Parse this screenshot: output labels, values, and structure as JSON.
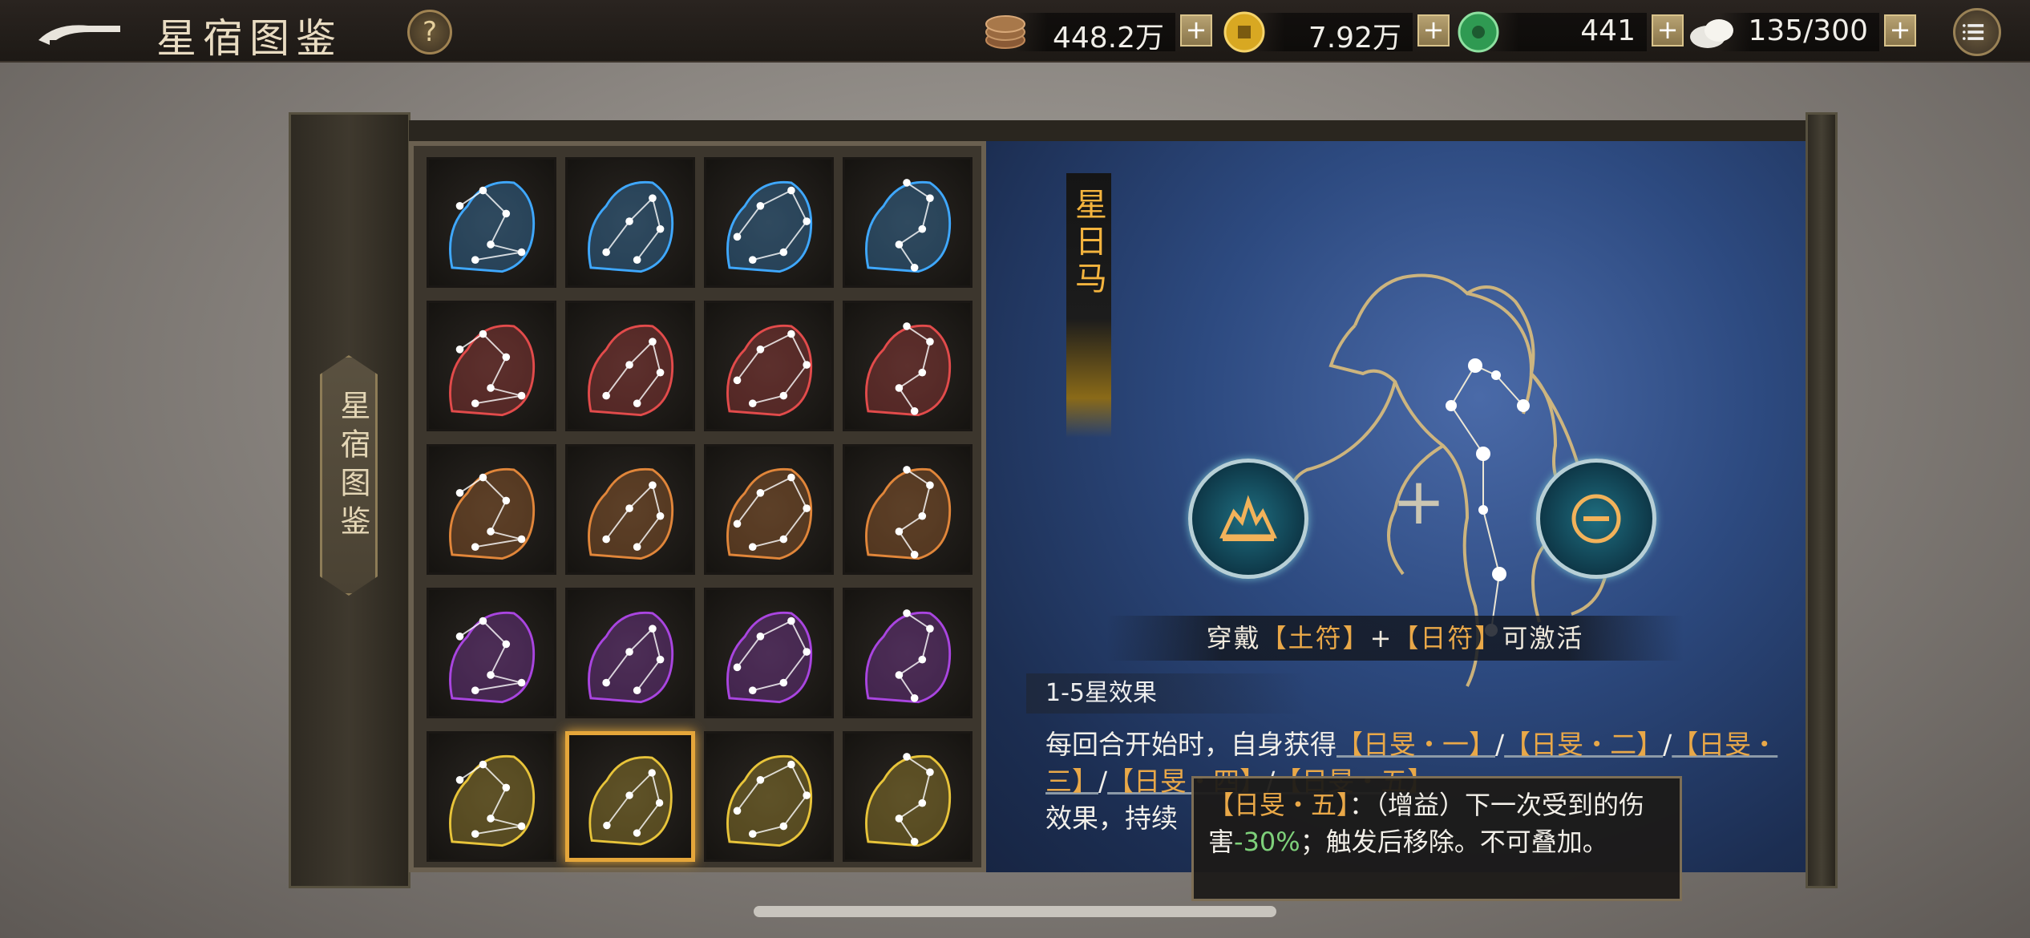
{
  "header": {
    "title": "星宿图鉴",
    "help_label": "?",
    "resources": [
      {
        "name": "copper-coins",
        "value": "448.2万",
        "plus": "+"
      },
      {
        "name": "gold-coin",
        "value": "7.92万",
        "plus": "+"
      },
      {
        "name": "jade",
        "value": "441",
        "plus": "+"
      },
      {
        "name": "stamina",
        "value": "135/300",
        "plus": "+"
      }
    ]
  },
  "side_tab": {
    "label": "星宿图鉴"
  },
  "grid": {
    "cells": [
      {
        "name": "blue-lion",
        "color": "#3fa8ff"
      },
      {
        "name": "blue-wolf",
        "color": "#3fa8ff"
      },
      {
        "name": "blue-beast",
        "color": "#3fa8ff"
      },
      {
        "name": "blue-serpent",
        "color": "#3fa8ff"
      },
      {
        "name": "red-boar",
        "color": "#e24b4b"
      },
      {
        "name": "red-snake",
        "color": "#e24b4b"
      },
      {
        "name": "red-tiger",
        "color": "#e24b4b"
      },
      {
        "name": "red-monkey",
        "color": "#e24b4b"
      },
      {
        "name": "orange-pheasant",
        "color": "#e1863a"
      },
      {
        "name": "orange-deer",
        "color": "#e1863a"
      },
      {
        "name": "orange-badger",
        "color": "#e1863a"
      },
      {
        "name": "orange-bat",
        "color": "#e1863a"
      },
      {
        "name": "purple-crane",
        "color": "#a945e0"
      },
      {
        "name": "purple-stag",
        "color": "#a945e0"
      },
      {
        "name": "purple-fox",
        "color": "#a945e0"
      },
      {
        "name": "purple-swallow",
        "color": "#a945e0"
      },
      {
        "name": "gold-rat",
        "color": "#e8c43a"
      },
      {
        "name": "gold-horse",
        "color": "#e8c43a",
        "selected": true
      },
      {
        "name": "gold-rabbit",
        "color": "#e8c43a"
      },
      {
        "name": "gold-rooster",
        "color": "#e8c43a"
      }
    ]
  },
  "detail": {
    "name": "星日马",
    "activate": {
      "prefix": "穿戴",
      "item1": "【土符】",
      "joiner": "+",
      "item2": "【日符】",
      "suffix": "可激活"
    },
    "effects_header": "1-5星效果",
    "effects_line1_prefix": "每回合开始时，自身获得",
    "effects_tag1": "【日旻・一】",
    "effects_sep1": "/",
    "effects_tag2": "【日旻・二】",
    "effects_sep2": "/",
    "effects_tag3": "【日旻・三】",
    "effects_sep3": "/",
    "effects_tag4": "【日旻・四】",
    "effects_sep4": "/",
    "effects_tag5": "【日旻・五】",
    "effects_line3": "效果，持续"
  },
  "tooltip": {
    "tag": "【日旻・五】",
    "text1": "：（增益）下一次受到的伤害",
    "value": "-30%",
    "text2": "；触发后移除。不可叠加。"
  }
}
